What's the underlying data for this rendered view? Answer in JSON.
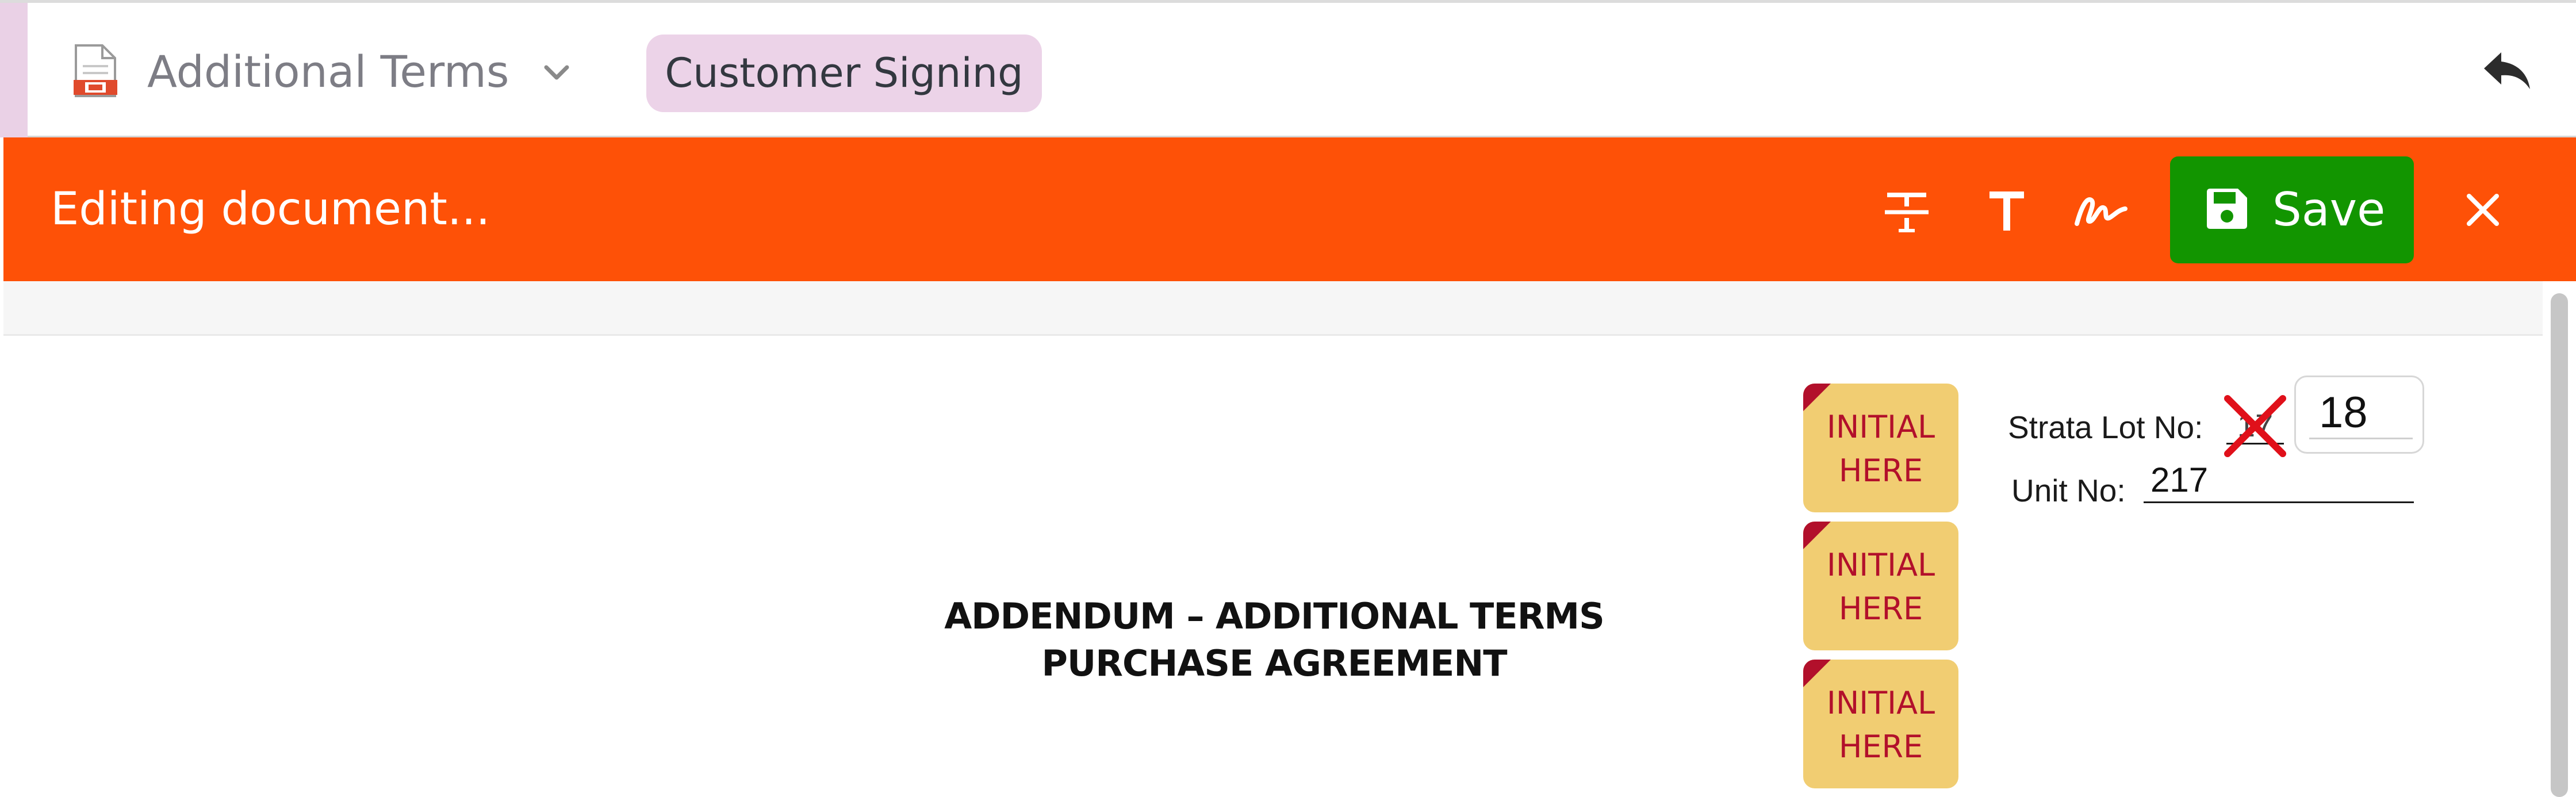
{
  "header": {
    "doc_icon": "pdf-file-icon",
    "document_title": "Additional Terms",
    "dropdown_icon": "chevron-down-icon",
    "stage_chip": "Customer Signing",
    "back_icon": "reply-arrow-icon"
  },
  "editbar": {
    "status": "Editing document...",
    "tools": [
      {
        "name": "strikethrough",
        "icon": "strikethrough-icon"
      },
      {
        "name": "text",
        "icon": "text-tool-icon"
      },
      {
        "name": "signature",
        "icon": "signature-icon"
      }
    ],
    "save_label": "Save",
    "save_icon": "floppy-disk-icon",
    "close_icon": "close-icon"
  },
  "document": {
    "initial_boxes": [
      {
        "line1": "INITIAL",
        "line2": "HERE"
      },
      {
        "line1": "INITIAL",
        "line2": "HERE"
      },
      {
        "line1": "INITIAL",
        "line2": "HERE"
      }
    ],
    "strata_lot_label": "Strata Lot No:",
    "strata_lot_crossed_value": "17",
    "strata_lot_value": "18",
    "unit_label": "Unit No:",
    "unit_value": "217",
    "heading_line1": "ADDENDUM – ADDITIONAL TERMS",
    "heading_line2": "PURCHASE AGREEMENT"
  },
  "colors": {
    "editbar_bg": "#fe5107",
    "save_bg": "#129500",
    "chip_bg": "#ecd3e8",
    "initial_bg": "#f1cd72",
    "initial_text": "#b2102b",
    "strike_mark": "#e0101a"
  }
}
